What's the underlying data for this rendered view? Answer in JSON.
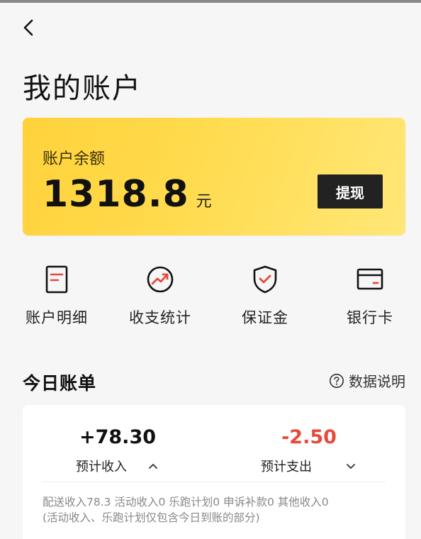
{
  "header": {
    "title": "我的账户"
  },
  "balance_card": {
    "label": "账户余额",
    "value": "1318.8",
    "unit": "元",
    "withdraw_label": "提现"
  },
  "shortcuts": [
    {
      "label": "账户明细",
      "icon": "document-icon"
    },
    {
      "label": "收支统计",
      "icon": "trend-chart-icon"
    },
    {
      "label": "保证金",
      "icon": "shield-check-icon"
    },
    {
      "label": "银行卡",
      "icon": "bank-card-icon"
    }
  ],
  "today": {
    "title": "今日账单",
    "data_link": "数据说明",
    "income": {
      "amount": "+78.30",
      "label": "预计收入"
    },
    "expense": {
      "amount": "-2.50",
      "label": "预计支出"
    },
    "detail_line1": "配送收入78.3 活动收入0 乐跑计划0 申诉补款0 其他收入0",
    "detail_line2": "(活动收入、乐跑计划仅包含今日到账的部分)"
  },
  "colors": {
    "accent": "#ffd23b",
    "icon_red": "#e64a3a",
    "expense": "#e64a3a"
  }
}
